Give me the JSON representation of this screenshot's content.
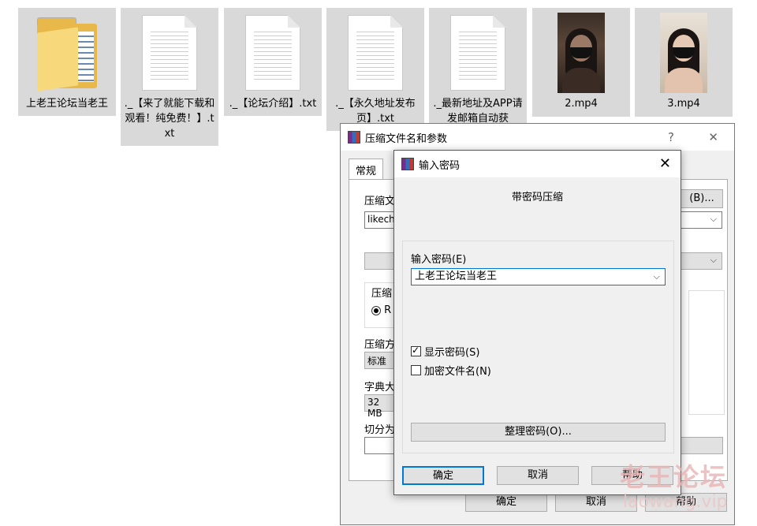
{
  "files": [
    {
      "name": "上老王论坛当老王",
      "kind": "folder",
      "icon": "folder-icon"
    },
    {
      "name": "._【来了就能下载和观看！纯免费！】.txt",
      "kind": "text",
      "icon": "text-file-icon"
    },
    {
      "name": "._【论坛介绍】.txt",
      "kind": "text",
      "icon": "text-file-icon"
    },
    {
      "name": "._【永久地址发布页】.txt",
      "kind": "text",
      "icon": "text-file-icon"
    },
    {
      "name": "._最新地址及APP请发邮箱自动获",
      "kind": "text",
      "icon": "text-file-icon"
    },
    {
      "name": "2.mp4",
      "kind": "video",
      "icon": "video-thumbnail"
    },
    {
      "name": "3.mp4",
      "kind": "video",
      "icon": "video-thumbnail"
    }
  ],
  "archive_dialog": {
    "title": "压缩文件名和参数",
    "help_glyph": "?",
    "close_glyph": "✕",
    "tab_general": "常规",
    "archive_name_label": "压缩文",
    "browse_button": "(B)...",
    "archive_name_value": "likecho",
    "format_group_label": "压缩",
    "format_option": "R",
    "method_label": "压缩方",
    "method_value": "标准",
    "dict_label": "字典大",
    "dict_value": "32 MB",
    "split_label": "切分为",
    "ok_label": "确定",
    "cancel_label": "取消",
    "help_label": "帮助"
  },
  "password_dialog": {
    "title": "输入密码",
    "close_glyph": "✕",
    "heading": "带密码压缩",
    "password_label": "输入密码(E)",
    "password_value": "上老王论坛当老王",
    "show_password_label": "显示密码(S)",
    "show_password_checked": true,
    "encrypt_names_label": "加密文件名(N)",
    "encrypt_names_checked": false,
    "organize_button": "整理密码(O)...",
    "ok_label": "确定",
    "cancel_label": "取消",
    "help_label": "帮助"
  },
  "watermark": {
    "line1": "老王论坛",
    "line2": "laowang.vip"
  }
}
